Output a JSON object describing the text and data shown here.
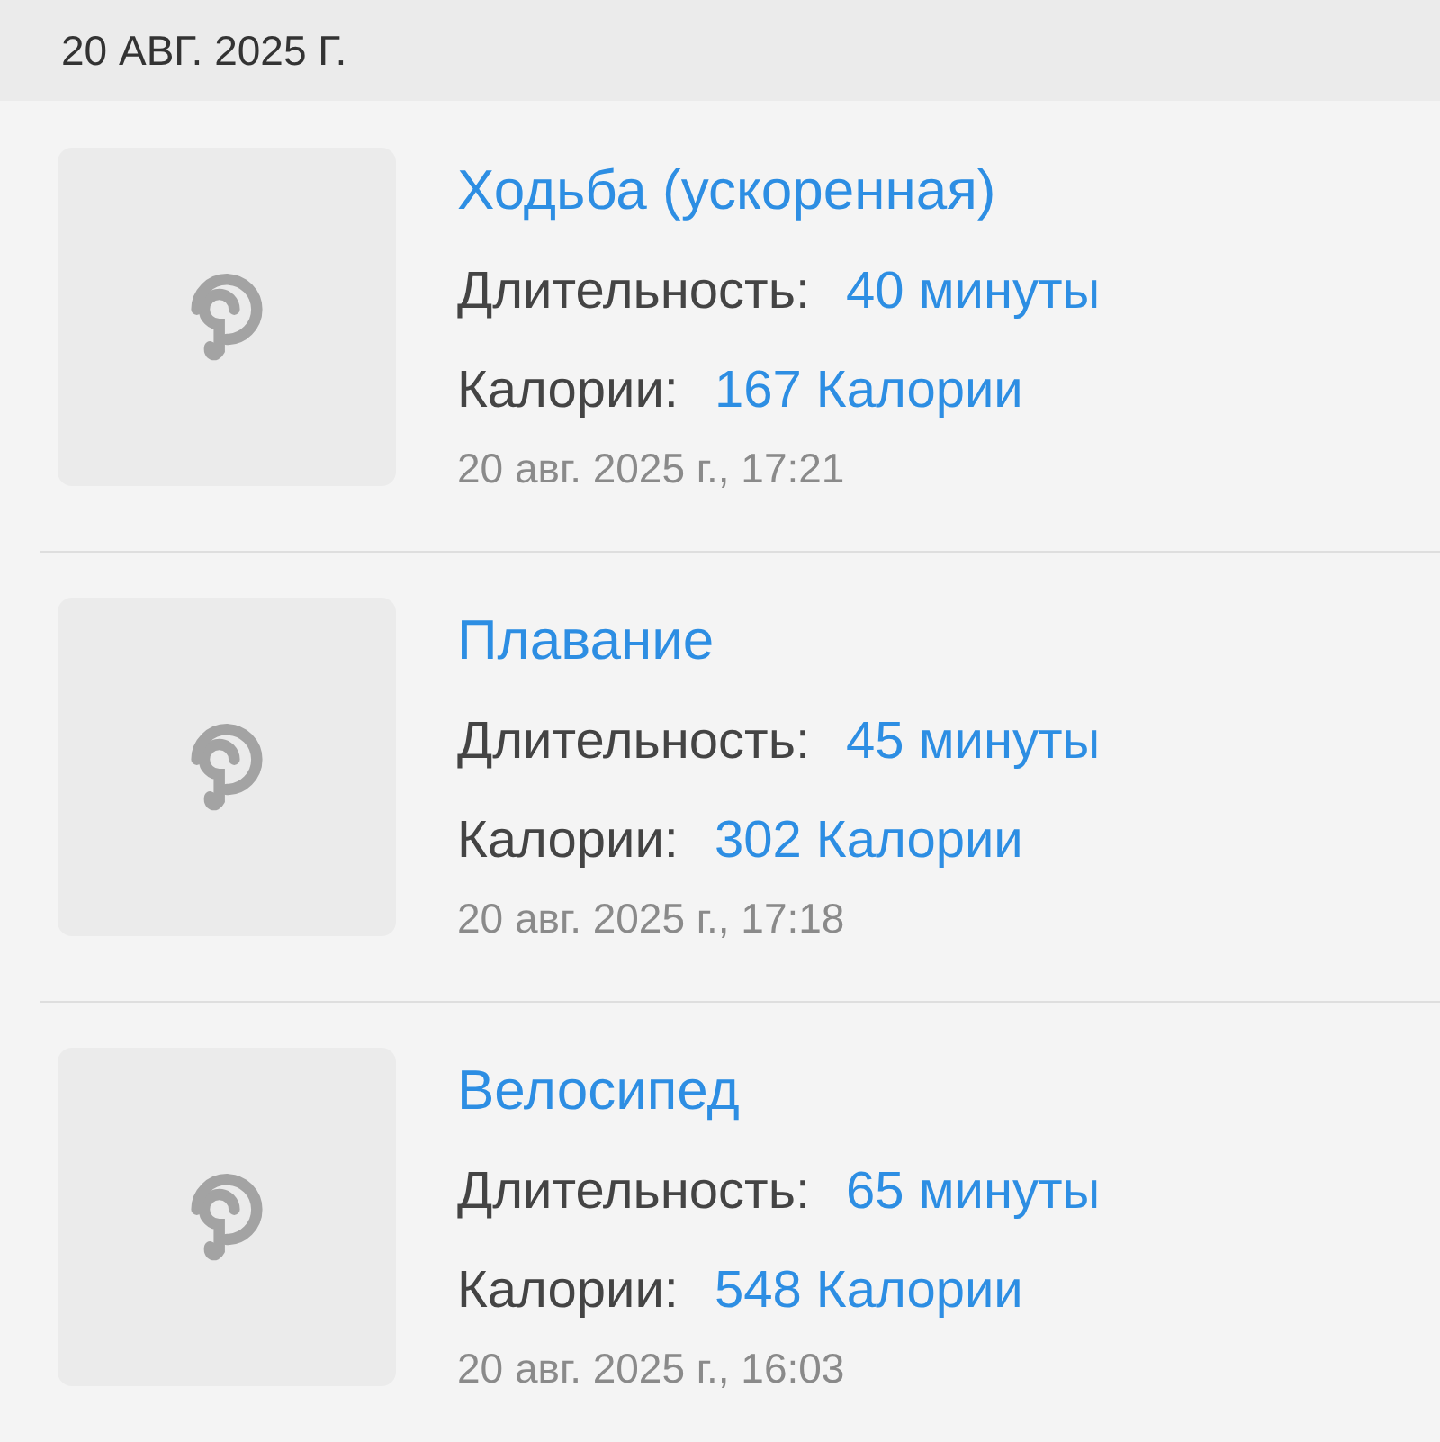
{
  "section_header": "20 АВГ. 2025 Г.",
  "workouts": [
    {
      "kind": "picture",
      "title": "Ходьба (ускоренная)",
      "duration_label": "Длительность:",
      "duration": "40 минуты",
      "calories_label": "Калории:",
      "calories": "167 Калории",
      "timestamp": "20 авг. 2025 г., 17:21"
    },
    {
      "kind": "picture",
      "title": "Плавание",
      "duration_label": "Длительность:",
      "duration": "45 минуты",
      "calories_label": "Калории:",
      "calories": "302 Калории",
      "timestamp": "20 авг. 2025 г., 17:18"
    },
    {
      "kind": "picture",
      "title": "Велосипед",
      "duration_label": "Длительность:",
      "duration": "65 минуты",
      "calories_label": "Калории:",
      "calories": "548 Калории",
      "timestamp": "20 авг. 2025 г., 16:03"
    }
  ]
}
